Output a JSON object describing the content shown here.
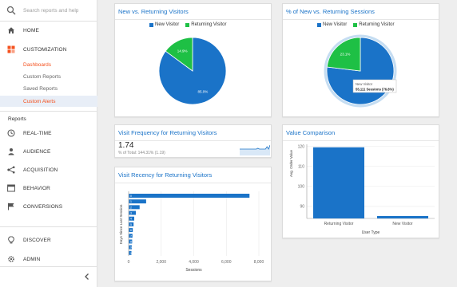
{
  "colors": {
    "blue": "#1a73c8",
    "green": "#1ec045",
    "accent": "#f4511e",
    "sidebar_bg": "#ffffff",
    "main_bg": "#eeeeee"
  },
  "search": {
    "placeholder": "Search reports and help"
  },
  "sidebar": {
    "home": {
      "label": "HOME",
      "icon": "home-icon"
    },
    "customization": {
      "label": "CUSTOMIZATION",
      "icon": "customization-icon"
    },
    "custom_items": [
      {
        "label": "Dashboards"
      },
      {
        "label": "Custom Reports"
      },
      {
        "label": "Saved Reports"
      },
      {
        "label": "Custom Alerts"
      }
    ],
    "reports_label": "Reports",
    "report_items": [
      {
        "label": "REAL-TIME",
        "icon": "clock-icon"
      },
      {
        "label": "AUDIENCE",
        "icon": "person-icon"
      },
      {
        "label": "ACQUISITION",
        "icon": "acquisition-icon"
      },
      {
        "label": "BEHAVIOR",
        "icon": "behavior-icon"
      },
      {
        "label": "CONVERSIONS",
        "icon": "flag-icon"
      }
    ],
    "discover": {
      "label": "DISCOVER",
      "icon": "lightbulb-icon"
    },
    "admin": {
      "label": "ADMIN",
      "icon": "gear-icon"
    },
    "collapse_icon": "chevron-left-icon"
  },
  "widgets": {
    "pie1": {
      "title": "New vs. Returning Visitors"
    },
    "pie2": {
      "title": "% of New vs. Returning Sessions"
    },
    "frequency": {
      "title": "Visit Frequency for Returning Visitors",
      "value": "1.74",
      "sub": "% of Total: 144.31% (1.19)"
    },
    "recency": {
      "title": "Visit Recency for Returning Visitors"
    },
    "comparison": {
      "title": "Value Comparison"
    }
  },
  "tooltip": {
    "line1": "New Visitor",
    "line2": "55,111 Sessions (76.8%)"
  },
  "chart_data": [
    {
      "id": "pie1",
      "type": "pie",
      "title": "New vs. Returning Visitors",
      "legend": "top",
      "series": [
        {
          "name": "New Visitor",
          "value": 85.1,
          "label": "85.0%",
          "color": "#1a73c8"
        },
        {
          "name": "Returning Visitor",
          "value": 14.9,
          "label": "14.9%",
          "color": "#1ec045"
        }
      ]
    },
    {
      "id": "pie2",
      "type": "pie",
      "title": "% of New vs. Returning Sessions",
      "legend": "top",
      "series": [
        {
          "name": "New Visitor",
          "value": 76.9,
          "label": "",
          "color": "#1a73c8"
        },
        {
          "name": "Returning Visitor",
          "value": 23.1,
          "label": "23.1%",
          "color": "#1ec045"
        }
      ]
    },
    {
      "id": "sparkline",
      "type": "line",
      "values": [
        4,
        4,
        4,
        4,
        4,
        4,
        4,
        4,
        4,
        4,
        4,
        4,
        4.5,
        4,
        4,
        4,
        4,
        4,
        5.5,
        4,
        6.5
      ]
    },
    {
      "id": "recency",
      "type": "bar",
      "orientation": "horizontal",
      "title": "Visit Recency for Returning Visitors",
      "xlabel": "Sessions",
      "ylabel": "Days Since Last Session",
      "xticks": [
        "0",
        "2,000",
        "4,000",
        "6,000",
        "8,000"
      ],
      "xlim": [
        0,
        8000
      ],
      "categories": [
        "0",
        "1",
        "2",
        "3",
        "4",
        "5",
        "6",
        "7",
        "8",
        "9",
        "10"
      ],
      "values": [
        7400,
        1050,
        650,
        420,
        320,
        280,
        230,
        210,
        190,
        170,
        150
      ]
    },
    {
      "id": "comparison",
      "type": "bar",
      "ylabel": "Avg. Order Value",
      "xlabel": "User Type",
      "yticks": [
        "90",
        "100",
        "110",
        "120"
      ],
      "ylim": [
        84,
        121
      ],
      "categories": [
        "Returning Visitor",
        "New Visitor"
      ],
      "values": [
        119.5,
        85.2
      ]
    }
  ]
}
